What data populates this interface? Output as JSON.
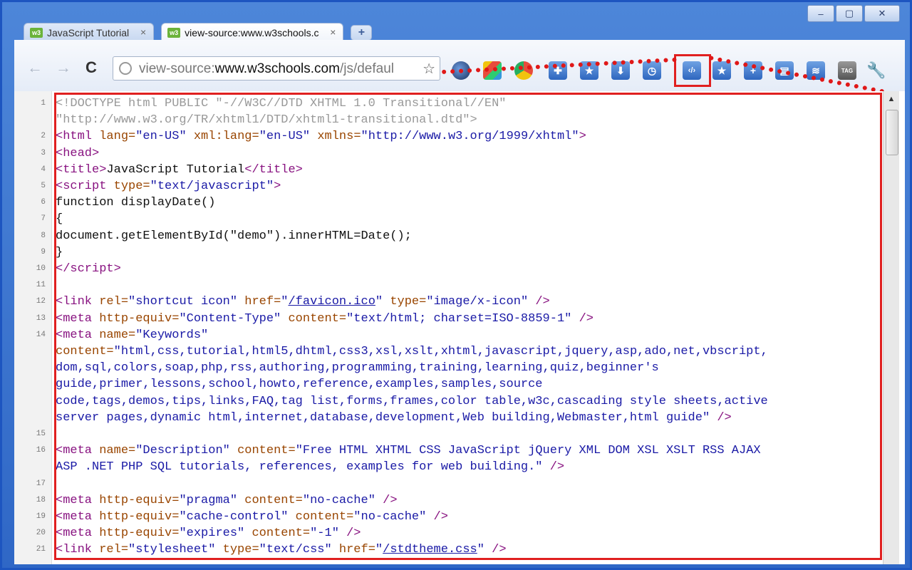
{
  "window": {
    "minimize_label": "–",
    "maximize_label": "▢",
    "close_label": "✕"
  },
  "tabs": [
    {
      "label": "JavaScript Tutorial",
      "active": false,
      "close": "×"
    },
    {
      "label": "view-source:www.w3schools.c",
      "active": true,
      "close": "×"
    }
  ],
  "newtab_label": "+",
  "toolbar": {
    "back": "←",
    "forward": "→",
    "reload": "C",
    "url_prefix": "view-source:",
    "url_host": "www.w3schools.com",
    "url_path": "/js/defaul",
    "bookmark_star": "☆",
    "extensions": [
      "sphere-icon",
      "puzzle-icon",
      "star-icon",
      "download-icon",
      "clock-icon",
      "source-code-icon",
      "rating-star-icon",
      "plus-icon",
      "print-icon",
      "layers-icon",
      "tag-icon"
    ],
    "source_icon_label": "‹/›",
    "wrench": "🔧"
  },
  "source_lines": [
    {
      "num": "1",
      "html": "<span class=\"c\">&lt;!DOCTYPE html PUBLIC \"-//W3C//DTD XHTML 1.0 Transitional//EN\"</span>"
    },
    {
      "num": "",
      "html": "<span class=\"c\">\"http://www.w3.org/TR/xhtml1/DTD/xhtml1-transitional.dtd\"&gt;</span>"
    },
    {
      "num": "2",
      "html": "<span class=\"t\">&lt;html </span><span class=\"a\">lang=</span><span class=\"v\">\"en-US\"</span> <span class=\"a\">xml:lang=</span><span class=\"v\">\"en-US\"</span> <span class=\"a\">xmlns=</span><span class=\"v\">\"http://www.w3.org/1999/xhtml\"</span><span class=\"t\">&gt;</span>"
    },
    {
      "num": "3",
      "html": "<span class=\"t\">&lt;head&gt;</span>"
    },
    {
      "num": "4",
      "html": "<span class=\"t\">&lt;title&gt;</span>JavaScript Tutorial<span class=\"t\">&lt;/title&gt;</span>"
    },
    {
      "num": "5",
      "html": "<span class=\"t\">&lt;script </span><span class=\"a\">type=</span><span class=\"v\">\"text/javascript\"</span><span class=\"t\">&gt;</span>"
    },
    {
      "num": "6",
      "html": "function displayDate()"
    },
    {
      "num": "7",
      "html": "{"
    },
    {
      "num": "8",
      "html": "document.getElementById(\"demo\").innerHTML=Date();"
    },
    {
      "num": "9",
      "html": "}"
    },
    {
      "num": "10",
      "html": "<span class=\"t\">&lt;/script&gt;</span>"
    },
    {
      "num": "11",
      "html": ""
    },
    {
      "num": "12",
      "html": "<span class=\"t\">&lt;link </span><span class=\"a\">rel=</span><span class=\"v\">\"shortcut icon\"</span> <span class=\"a\">href=</span><span class=\"v\">\"</span><span class=\"lk\">/favicon.ico</span><span class=\"v\">\"</span> <span class=\"a\">type=</span><span class=\"v\">\"image/x-icon\"</span> <span class=\"t\">/&gt;</span>"
    },
    {
      "num": "13",
      "html": "<span class=\"t\">&lt;meta </span><span class=\"a\">http-equiv=</span><span class=\"v\">\"Content-Type\"</span> <span class=\"a\">content=</span><span class=\"v\">\"text/html; charset=ISO-8859-1\"</span> <span class=\"t\">/&gt;</span>"
    },
    {
      "num": "14",
      "html": "<span class=\"t\">&lt;meta </span><span class=\"a\">name=</span><span class=\"v\">\"Keywords\"</span>"
    },
    {
      "num": "",
      "html": "<span class=\"a\">content=</span><span class=\"v\">\"html,css,tutorial,html5,dhtml,css3,xsl,xslt,xhtml,javascript,jquery,asp,ado,net,vbscript,</span>"
    },
    {
      "num": "",
      "html": "<span class=\"v\">dom,sql,colors,soap,php,rss,authoring,programming,training,learning,quiz,beginner's</span>"
    },
    {
      "num": "",
      "html": "<span class=\"v\">guide,primer,lessons,school,howto,reference,examples,samples,source</span>"
    },
    {
      "num": "",
      "html": "<span class=\"v\">code,tags,demos,tips,links,FAQ,tag list,forms,frames,color table,w3c,cascading style sheets,active</span>"
    },
    {
      "num": "",
      "html": "<span class=\"v\">server pages,dynamic html,internet,database,development,Web building,Webmaster,html guide\"</span> <span class=\"t\">/&gt;</span>"
    },
    {
      "num": "15",
      "html": ""
    },
    {
      "num": "16",
      "html": "<span class=\"t\">&lt;meta </span><span class=\"a\">name=</span><span class=\"v\">\"Description\"</span> <span class=\"a\">content=</span><span class=\"v\">\"Free HTML XHTML CSS JavaScript jQuery XML DOM XSL XSLT RSS AJAX</span>"
    },
    {
      "num": "",
      "html": "<span class=\"v\">ASP .NET PHP SQL tutorials, references, examples for web building.\"</span> <span class=\"t\">/&gt;</span>"
    },
    {
      "num": "17",
      "html": ""
    },
    {
      "num": "18",
      "html": "<span class=\"t\">&lt;meta </span><span class=\"a\">http-equiv=</span><span class=\"v\">\"pragma\"</span> <span class=\"a\">content=</span><span class=\"v\">\"no-cache\"</span> <span class=\"t\">/&gt;</span>"
    },
    {
      "num": "19",
      "html": "<span class=\"t\">&lt;meta </span><span class=\"a\">http-equiv=</span><span class=\"v\">\"cache-control\"</span> <span class=\"a\">content=</span><span class=\"v\">\"no-cache\"</span> <span class=\"t\">/&gt;</span>"
    },
    {
      "num": "20",
      "html": "<span class=\"t\">&lt;meta </span><span class=\"a\">http-equiv=</span><span class=\"v\">\"expires\"</span> <span class=\"a\">content=</span><span class=\"v\">\"-1\"</span> <span class=\"t\">/&gt;</span>"
    },
    {
      "num": "21",
      "html": "<span class=\"t\">&lt;link </span><span class=\"a\">rel=</span><span class=\"v\">\"stylesheet\"</span> <span class=\"a\">type=</span><span class=\"v\">\"text/css\"</span> <span class=\"a\">href=</span><span class=\"v\">\"</span><span class=\"lk\">/stdtheme.css</span><span class=\"v\">\"</span> <span class=\"t\">/&gt;</span>"
    }
  ],
  "colors": {
    "highlight": "#e02020",
    "frame": "#1d55c0"
  }
}
